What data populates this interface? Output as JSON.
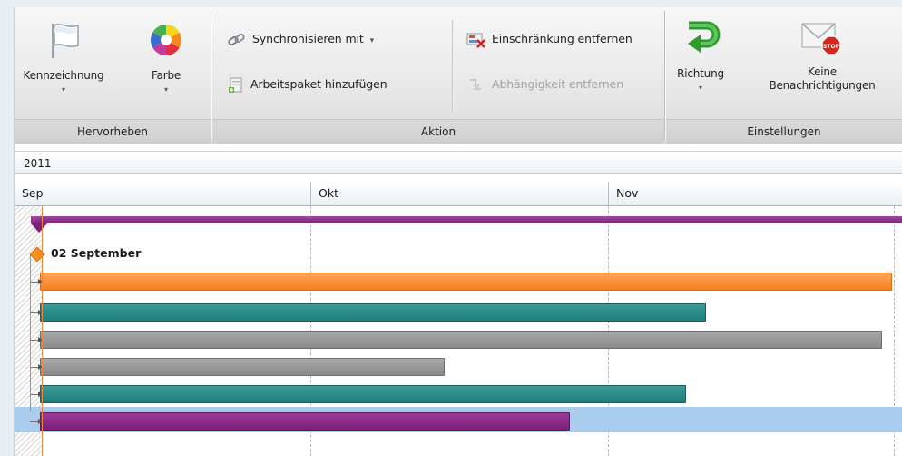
{
  "ribbon": {
    "groups": {
      "hervorheben": "Hervorheben",
      "aktion": "Aktion",
      "einstellungen": "Einstellungen"
    },
    "buttons": {
      "kennzeichnung": "Kennzeichnung",
      "farbe": "Farbe",
      "synchronisieren": "Synchronisieren mit",
      "synchronisieren_arrow": "▾",
      "arbeitspaket": "Arbeitspaket hinzufügen",
      "einschraenkung": "Einschränkung entfernen",
      "abhaengigkeit": "Abhängigkeit entfernen",
      "richtung": "Richtung",
      "keine_line1": "Keine",
      "keine_line2": "Benachrichtigungen",
      "stop_icon_text": "STOP",
      "dropdown_arrow": "▾"
    }
  },
  "timeline": {
    "year": "2011",
    "months": [
      "Sep",
      "Okt",
      "Nov"
    ]
  },
  "milestone": {
    "label": "02 September"
  },
  "icons": {
    "flag": "flag-icon",
    "color_wheel": "color-wheel-icon",
    "sync": "chain-link-icon",
    "add_package": "add-package-icon",
    "remove_constraint": "remove-constraint-icon",
    "remove_dependency": "remove-dependency-icon",
    "direction": "green-u-turn-arrow-icon",
    "no_notifications": "stop-envelope-icon"
  },
  "colors": {
    "summary": "#7d1f79",
    "orange": "#f57d1e",
    "teal": "#1f7d79",
    "gray": "#8a8a8a",
    "purple": "#7b1f78",
    "selected_row": "#aacdee",
    "today_line": "#f0873a"
  },
  "tasks": [
    {
      "row": 1,
      "color": "orange",
      "bar_start": "2011-09-02",
      "bar_end": "2011-11-30"
    },
    {
      "row": 2,
      "color": "teal",
      "bar_start": "2011-09-02",
      "bar_end": "2011-11-11"
    },
    {
      "row": 3,
      "color": "gray",
      "bar_start": "2011-09-02",
      "bar_end": "2011-11-29"
    },
    {
      "row": 4,
      "color": "gray",
      "bar_start": "2011-09-02",
      "bar_end": "2011-10-15"
    },
    {
      "row": 5,
      "color": "teal",
      "bar_start": "2011-09-02",
      "bar_end": "2011-11-09"
    },
    {
      "row": 6,
      "color": "purple",
      "bar_start": "2011-09-02",
      "bar_end": "2011-10-28",
      "selected": true
    }
  ]
}
